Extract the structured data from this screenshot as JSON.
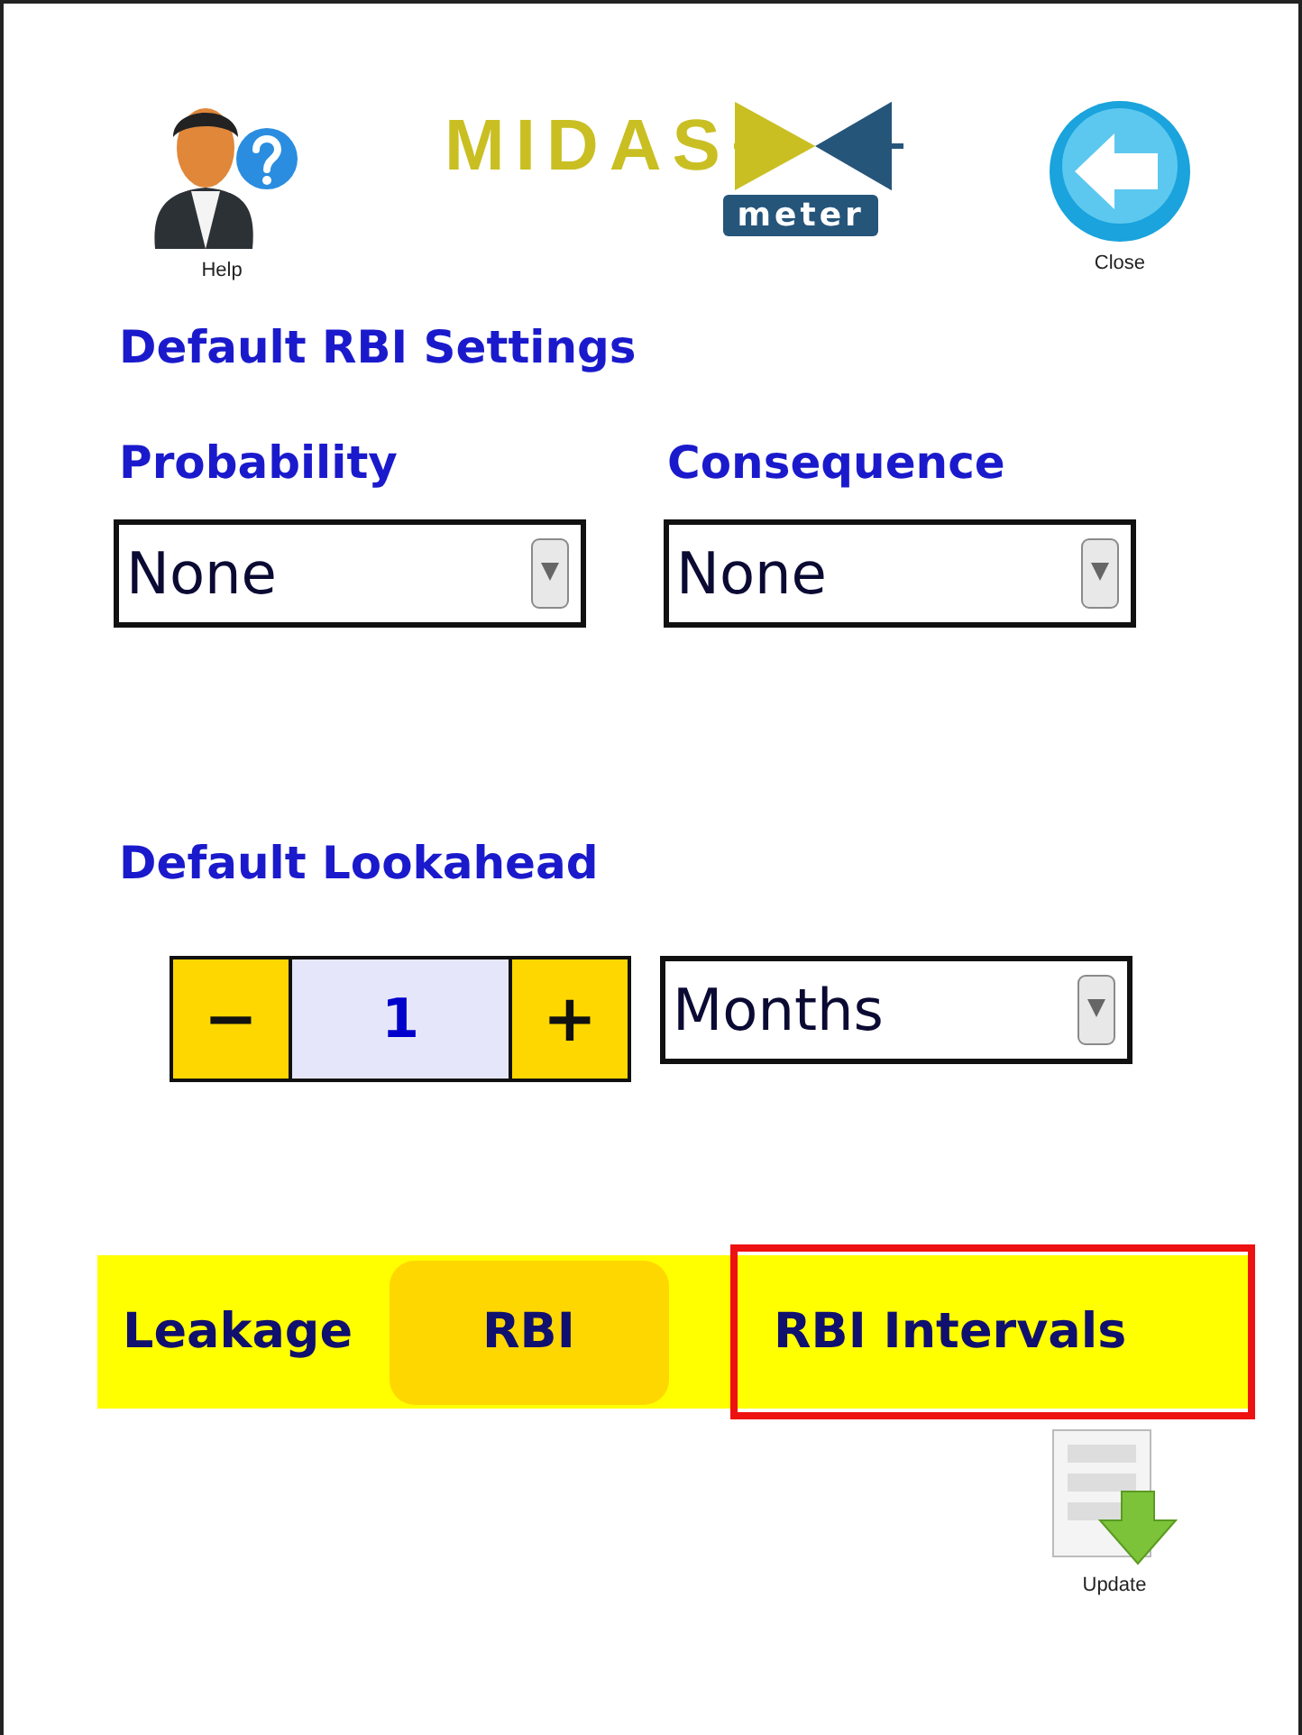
{
  "header": {
    "help": {
      "label": "Help"
    },
    "logo": {
      "name": "MIDAS",
      "sub": "meter"
    },
    "close": {
      "label": "Close"
    }
  },
  "rbi_settings": {
    "title": "Default RBI Settings",
    "fields": [
      {
        "label": "Probability",
        "value": "None"
      },
      {
        "label": "Consequence",
        "value": "None"
      }
    ]
  },
  "lookahead": {
    "title": "Default Lookahead",
    "decrement": "−",
    "value": "1",
    "increment": "+",
    "unit": "Months"
  },
  "tabs": [
    {
      "label": "Leakage",
      "selected": false,
      "outlined": false
    },
    {
      "label": "RBI",
      "selected": true,
      "outlined": false
    },
    {
      "label": "RBI Intervals",
      "selected": false,
      "outlined": true
    }
  ],
  "update": {
    "label": "Update"
  }
}
